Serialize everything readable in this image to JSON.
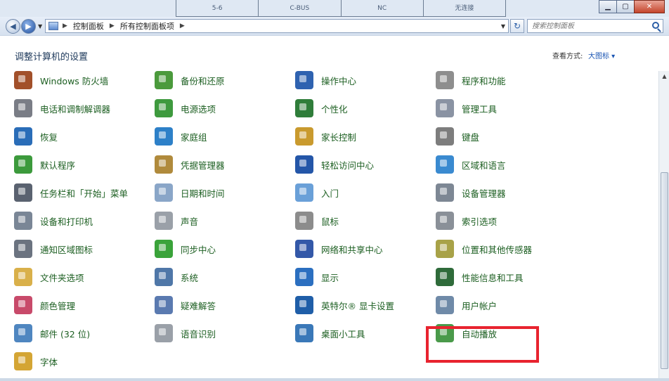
{
  "background_doc": {
    "cells": [
      "5-6",
      "C-BUS",
      "NC",
      "无连接"
    ]
  },
  "window": {
    "controls": {
      "minimize": "▁",
      "maximize": "▢",
      "close": "✕"
    }
  },
  "navbar": {
    "back": "◀",
    "forward": "▶",
    "breadcrumbs": [
      "控制面板",
      "所有控制面板项"
    ],
    "search_placeholder": "搜索控制面板",
    "refresh": "↻"
  },
  "header": {
    "title": "调整计算机的设置",
    "view_by_label": "查看方式:",
    "view_by_value": "大图标"
  },
  "items": [
    {
      "label": "Windows 防火墙",
      "icon": "firewall-icon",
      "color": "#a2502a"
    },
    {
      "label": "备份和还原",
      "icon": "backup-icon",
      "color": "#4b9a3c"
    },
    {
      "label": "操作中心",
      "icon": "action-center-flag-icon",
      "color": "#2f62b0"
    },
    {
      "label": "程序和功能",
      "icon": "programs-icon",
      "color": "#8e8e8e"
    },
    {
      "label": "电话和调制解调器",
      "icon": "phone-modem-icon",
      "color": "#7a7d86"
    },
    {
      "label": "电源选项",
      "icon": "power-icon",
      "color": "#3e9a3e"
    },
    {
      "label": "个性化",
      "icon": "personalization-icon",
      "color": "#2f7d3a"
    },
    {
      "label": "管理工具",
      "icon": "admin-tools-icon",
      "color": "#8a93a3"
    },
    {
      "label": "恢复",
      "icon": "recovery-icon",
      "color": "#2a6db8"
    },
    {
      "label": "家庭组",
      "icon": "homegroup-icon",
      "color": "#2d80c8"
    },
    {
      "label": "家长控制",
      "icon": "parental-controls-icon",
      "color": "#c99a2e"
    },
    {
      "label": "键盘",
      "icon": "keyboard-icon",
      "color": "#7d7d7d"
    },
    {
      "label": "默认程序",
      "icon": "default-programs-icon",
      "color": "#3c9a3c"
    },
    {
      "label": "凭据管理器",
      "icon": "credential-manager-icon",
      "color": "#b08a3c"
    },
    {
      "label": "轻松访问中心",
      "icon": "ease-of-access-icon",
      "color": "#2456a8"
    },
    {
      "label": "区域和语言",
      "icon": "region-language-icon",
      "color": "#3a8ad0"
    },
    {
      "label": "任务栏和「开始」菜单",
      "icon": "taskbar-icon",
      "color": "#5a6270"
    },
    {
      "label": "日期和时间",
      "icon": "date-time-icon",
      "color": "#8aa6c8"
    },
    {
      "label": "入门",
      "icon": "getting-started-icon",
      "color": "#6aa0d8"
    },
    {
      "label": "设备管理器",
      "icon": "device-manager-icon",
      "color": "#7d8794"
    },
    {
      "label": "设备和打印机",
      "icon": "printer-icon",
      "color": "#7a8696"
    },
    {
      "label": "声音",
      "icon": "speaker-icon",
      "color": "#9aa0a8"
    },
    {
      "label": "鼠标",
      "icon": "mouse-icon",
      "color": "#8c8c8c"
    },
    {
      "label": "索引选项",
      "icon": "indexing-icon",
      "color": "#8a9098"
    },
    {
      "label": "通知区域图标",
      "icon": "notification-area-icon",
      "color": "#6b7380"
    },
    {
      "label": "同步中心",
      "icon": "sync-center-icon",
      "color": "#3aa33a"
    },
    {
      "label": "网络和共享中心",
      "icon": "network-sharing-icon",
      "color": "#3358a8"
    },
    {
      "label": "位置和其他传感器",
      "icon": "location-sensors-icon",
      "color": "#a8a248"
    },
    {
      "label": "文件夹选项",
      "icon": "folder-options-icon",
      "color": "#d9b04a"
    },
    {
      "label": "系统",
      "icon": "system-icon",
      "color": "#4f77a8"
    },
    {
      "label": "显示",
      "icon": "display-icon",
      "color": "#2b6fc0"
    },
    {
      "label": "性能信息和工具",
      "icon": "performance-icon",
      "color": "#2f6b3a"
    },
    {
      "label": "颜色管理",
      "icon": "color-management-icon",
      "color": "#c84a6a"
    },
    {
      "label": "疑难解答",
      "icon": "troubleshooting-icon",
      "color": "#5a7ab0"
    },
    {
      "label": "英特尔® 显卡设置",
      "icon": "intel-graphics-icon",
      "color": "#1f5ea8"
    },
    {
      "label": "用户帐户",
      "icon": "user-accounts-icon",
      "color": "#6f8aa8"
    },
    {
      "label": "邮件 (32 位)",
      "icon": "mail-icon",
      "color": "#4f86c0"
    },
    {
      "label": "语音识别",
      "icon": "microphone-icon",
      "color": "#9aa0a8"
    },
    {
      "label": "桌面小工具",
      "icon": "gadgets-icon",
      "color": "#3a78b8"
    },
    {
      "label": "自动播放",
      "icon": "autoplay-icon",
      "color": "#4a9a4a"
    },
    {
      "label": "字体",
      "icon": "fonts-icon",
      "color": "#d4a534"
    }
  ]
}
